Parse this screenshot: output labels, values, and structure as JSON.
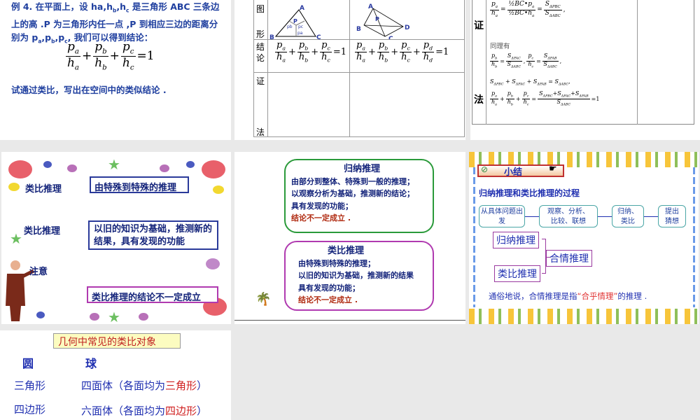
{
  "slide1": {
    "text1": "例 4. 在平面上，设 h",
    "text1_rest": "是三角形 ABC 三条边上的高 .P 为三角形内任一点 ,P 到相应三边的距离分别为 p",
    "text1_end": "我们可以得到结论：",
    "subs": [
      "a",
      "b",
      "c"
    ],
    "eq": "=1",
    "prompt": "试通过类比，写出在空间中的类似结论 ."
  },
  "slide2": {
    "row_labels": [
      "图",
      "形",
      "结",
      "论",
      "证",
      "法"
    ],
    "tri_labels": [
      "A",
      "B",
      "C",
      "P",
      "pb",
      "pc",
      "pa"
    ],
    "tet_labels": [
      "A",
      "B",
      "C",
      "D",
      "P"
    ],
    "eq": "=1"
  },
  "slide3": {
    "zheng": "证",
    "fa": "法",
    "same": "同理有",
    "eq_end": "=1"
  },
  "slide4": {
    "label1": "类比推理",
    "box1": "由特殊到特殊的推理",
    "label2": "类比推理",
    "box2": "以旧的知识为基础，推测新的结果，具有发现的功能",
    "label3": "注意",
    "box3": "类比推理的结论不一定成立"
  },
  "slide5": {
    "title1": "归纳推理",
    "lines1": [
      "由部分到整体、特殊到一般的推理；",
      "以观察分析为基础，推测新的结论；",
      "具有发现的功能；"
    ],
    "warn1": "结论不一定成立 .",
    "title2": "类比推理",
    "lines2": [
      "由特殊到特殊的推理；",
      "以旧的知识为基础，推测新的结果",
      "具有发现的功能；"
    ],
    "warn2": "结论不一定成立 ."
  },
  "slide6": {
    "title": "小结",
    "subtitle": "归纳推理和类比推理的过程",
    "flow": [
      "从具体问题出发",
      "观察、分析、比较、联想",
      "归纳、类比",
      "提出猜想"
    ],
    "box_a": "归纳推理",
    "box_b": "类比推理",
    "box_c": "合情推理",
    "summary_pre": "通俗地说，合情推理是指",
    "summary_quote": "“合乎情理”",
    "summary_post": "的推理 .",
    "colors": {
      "accent": "#e03030",
      "text": "#1f2fb0"
    }
  },
  "slide7": {
    "title": "几何中常见的类比对象",
    "rows": [
      {
        "left": "圆",
        "right": "球"
      },
      {
        "left": "三角形",
        "right_pre": "四面体（各面均为",
        "right_red": "三角形",
        "right_post": "）"
      },
      {
        "left": "四边形",
        "right_pre": "六面体（各面均为",
        "right_red": "四边形",
        "right_post": "）"
      }
    ]
  }
}
